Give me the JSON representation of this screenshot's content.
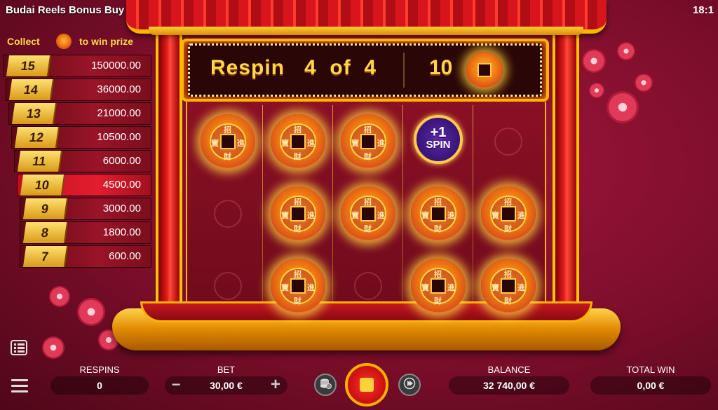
{
  "window": {
    "title": "Budai Reels Bonus Buy",
    "clock": "18:1"
  },
  "banner": {
    "respin_word": "Respin",
    "respin_current": "4",
    "respin_of": "of",
    "respin_total": "4",
    "coin_count": "10"
  },
  "paytable": {
    "collect_text": "Collect",
    "to_win_text": "to win prize",
    "rows": [
      {
        "count": "15",
        "prize": "150000.00"
      },
      {
        "count": "14",
        "prize": "36000.00"
      },
      {
        "count": "13",
        "prize": "21000.00"
      },
      {
        "count": "12",
        "prize": "10500.00"
      },
      {
        "count": "11",
        "prize": "6000.00"
      },
      {
        "count": "10",
        "prize": "4500.00",
        "active": true
      },
      {
        "count": "9",
        "prize": "3000.00"
      },
      {
        "count": "8",
        "prize": "1800.00"
      },
      {
        "count": "7",
        "prize": "600.00"
      }
    ]
  },
  "grid": {
    "columns": 5,
    "rows": 3,
    "cells": [
      [
        "coin",
        "coin",
        "coin",
        "spin",
        "empty"
      ],
      [
        "empty",
        "coin",
        "coin",
        "coin",
        "coin"
      ],
      [
        "empty",
        "coin",
        "empty",
        "coin",
        "coin"
      ]
    ],
    "spin_symbol": {
      "top": "+1",
      "bottom": "SPIN"
    },
    "coin_glyphs": {
      "top": "招",
      "left": "寶",
      "right": "進",
      "bottom": "財"
    }
  },
  "bottom_bar": {
    "respins_label": "RESPINS",
    "respins_value": "0",
    "bet_label": "BET",
    "bet_value": "30,00 €",
    "bet_minus": "−",
    "bet_plus": "+",
    "balance_label": "BALANCE",
    "balance_value": "32 740,00 €",
    "total_win_label": "TOTAL WIN",
    "total_win_value": "0,00 €"
  },
  "colors": {
    "accent_gold": "#ffd64a",
    "reel_bg": "#7a0e20",
    "stop_red": "#e01818"
  }
}
